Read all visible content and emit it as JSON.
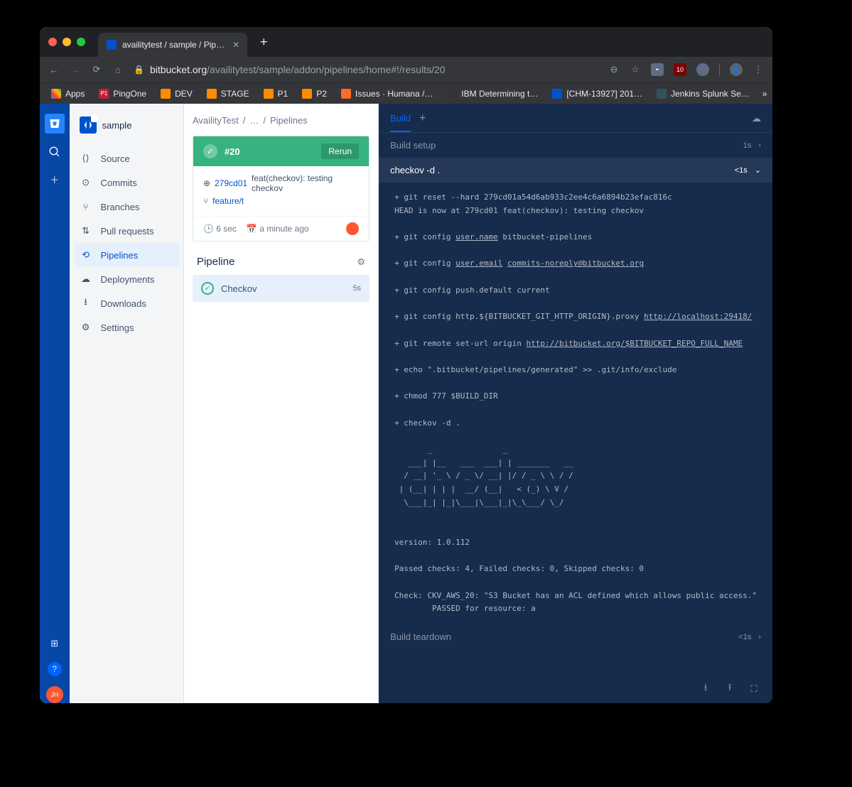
{
  "browser": {
    "tab_title": "availitytest / sample / Pipelines",
    "url_host": "bitbucket.org",
    "url_path": "/availitytest/sample/addon/pipelines/home#!/results/20",
    "bookmarks": [
      {
        "label": "Apps"
      },
      {
        "label": "PingOne"
      },
      {
        "label": "DEV"
      },
      {
        "label": "STAGE"
      },
      {
        "label": "P1"
      },
      {
        "label": "P2"
      },
      {
        "label": "Issues · Humana /…"
      },
      {
        "label": "IBM Determining t…"
      },
      {
        "label": "[CHM-13927] 201…"
      },
      {
        "label": "Jenkins Splunk Se…"
      }
    ]
  },
  "project": {
    "name": "sample"
  },
  "sidebar": {
    "items": [
      {
        "label": "Source"
      },
      {
        "label": "Commits"
      },
      {
        "label": "Branches"
      },
      {
        "label": "Pull requests"
      },
      {
        "label": "Pipelines"
      },
      {
        "label": "Deployments"
      },
      {
        "label": "Downloads"
      },
      {
        "label": "Settings"
      }
    ]
  },
  "breadcrumb": {
    "a": "AvailityTest",
    "b": "…",
    "c": "Pipelines"
  },
  "run": {
    "number": "#20",
    "rerun": "Rerun",
    "hash": "279cd01",
    "msg": "feat(checkov): testing checkov",
    "branch": "feature/t",
    "duration": "6 sec",
    "when": "a minute ago"
  },
  "pipeline": {
    "title": "Pipeline",
    "step_label": "Checkov",
    "step_dur": "5s"
  },
  "log": {
    "tab": "Build",
    "setup": "Build setup",
    "setup_t": "1s",
    "cmd": "checkov -d .",
    "cmd_t": "<1s",
    "teardown": "Build teardown",
    "teardown_t": "<1s",
    "lines": {
      "l1a": "+ git reset --hard 279cd01a54d6ab933c2ee4c6a6894b23efac816c",
      "l1b": "HEAD is now at 279cd01 feat(checkov): testing checkov",
      "l2": "+ git config ",
      "l2u": "user.name",
      "l2b": " bitbucket-pipelines",
      "l3": "+ git config ",
      "l3u": "user.email",
      "l3b": " ",
      "l3c": "commits-noreply@bitbucket.org",
      "l4": "+ git config push.default current",
      "l5": "+ git config http.${BITBUCKET_GIT_HTTP_ORIGIN}.proxy ",
      "l5u": "http://localhost:29418/",
      "l6": "+ git remote set-url origin ",
      "l6u": "http://bitbucket.org/$BITBUCKET_REPO_FULL_NAME",
      "l7": "+ echo \".bitbucket/pipelines/generated\" >> .git/info/exclude",
      "l8": "+ chmod 777 $BUILD_DIR",
      "l9": "+ checkov -d .",
      "ascii": "       _               _              \n   ___| |__   ___  ___| | _______   __\n  / __| '_ \\ / _ \\/ __| |/ / _ \\ \\ / /\n | (__| | | |  __/ (__|   < (_) \\ V / \n  \\___|_| |_|\\___|\\___|_|\\_\\___/ \\_/  \n                                      ",
      "ver": "version: 1.0.112",
      "sum": "Passed checks: 4, Failed checks: 0, Skipped checks: 0",
      "chk1": "Check: CKV_AWS_20: \"S3 Bucket has an ACL defined which allows public access.\"",
      "chk2": "        PASSED for resource: a"
    }
  }
}
